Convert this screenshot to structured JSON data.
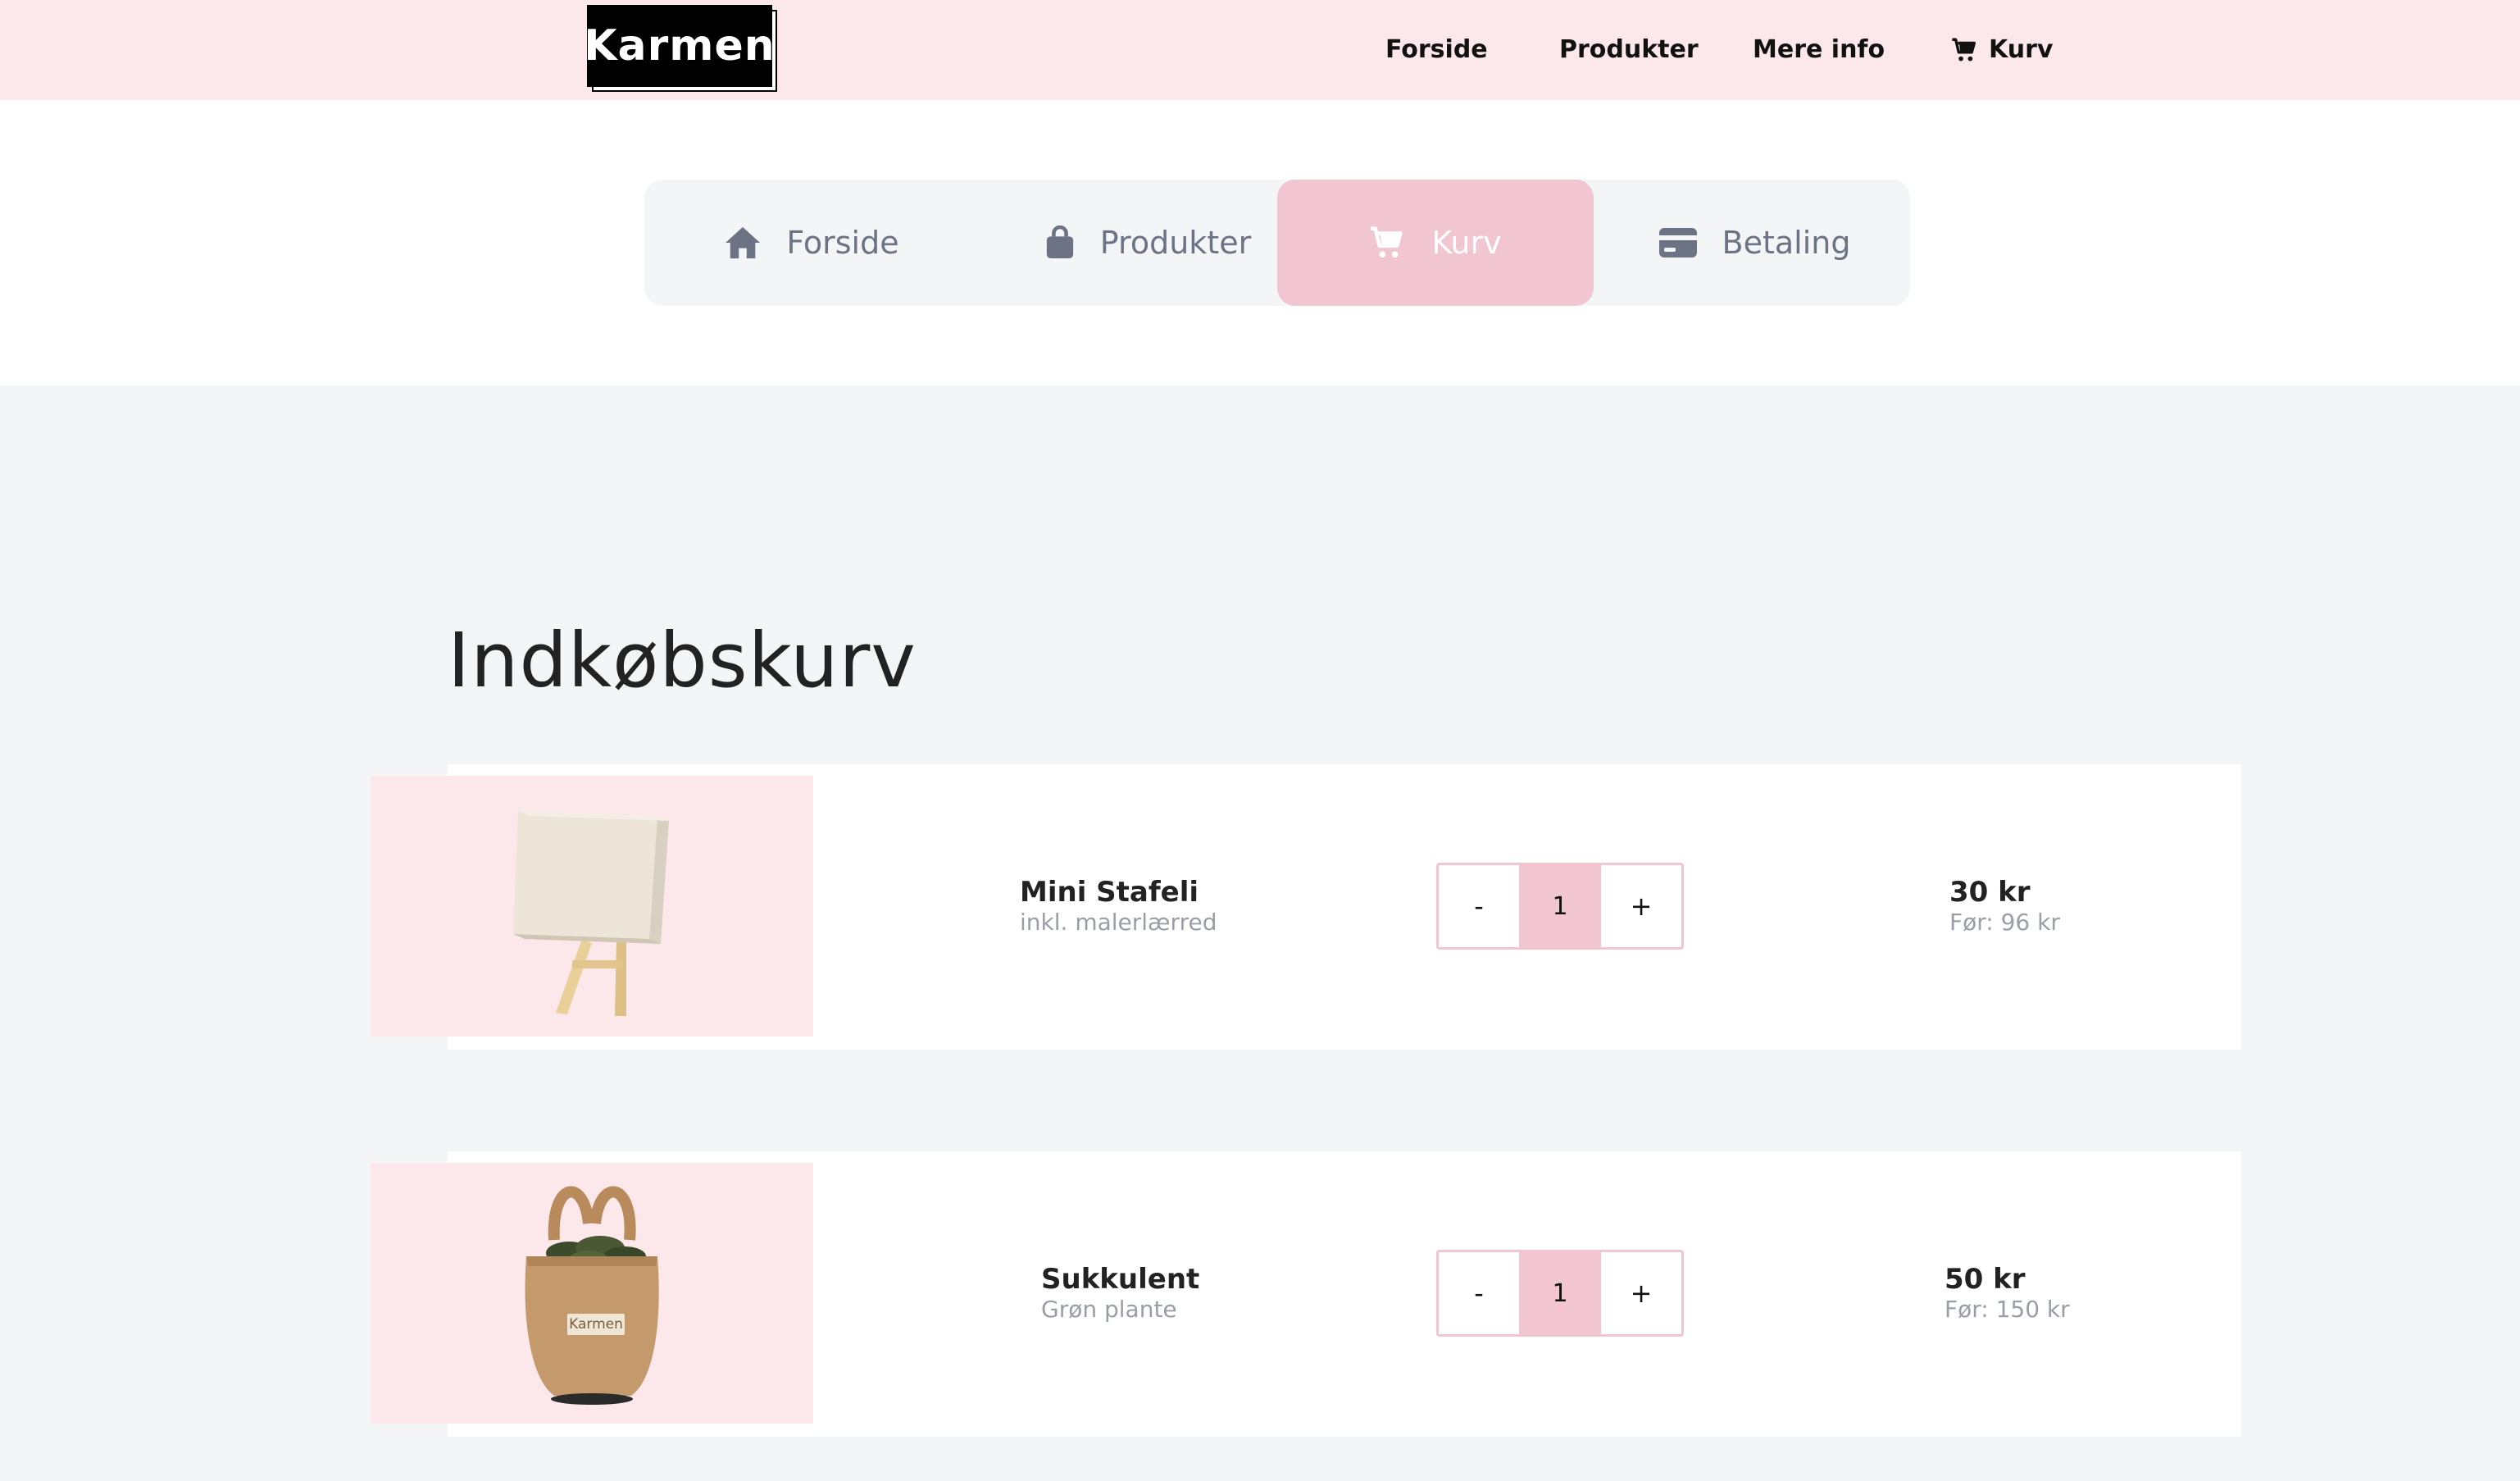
{
  "header": {
    "logo_text": "Karmen",
    "nav": [
      {
        "label": "Forside"
      },
      {
        "label": "Produkter"
      },
      {
        "label": "Mere info"
      },
      {
        "label": "Kurv",
        "icon": "cart-icon"
      }
    ]
  },
  "steps": [
    {
      "label": "Forside",
      "icon": "home-icon",
      "active": false
    },
    {
      "label": "Produkter",
      "icon": "shopping-bag-icon",
      "active": false
    },
    {
      "label": "Kurv",
      "icon": "cart-icon",
      "active": true
    },
    {
      "label": "Betaling",
      "icon": "credit-card-icon",
      "active": false
    }
  ],
  "cart": {
    "title": "Indkøbskurv",
    "items": [
      {
        "name": "Mini Stafeli",
        "subtitle": "inkl. malerlærred",
        "quantity": "1",
        "price": "30 kr",
        "before": "Før: 96 kr",
        "decrement": "-",
        "increment": "+"
      },
      {
        "name": "Sukkulent",
        "subtitle": "Grøn plante",
        "quantity": "1",
        "price": "50 kr",
        "before": "Før: 150 kr",
        "decrement": "-",
        "increment": "+",
        "product_print": "Karmen"
      }
    ]
  },
  "colors": {
    "header_bg": "#fce8ea",
    "accent_pink": "#f1c6d1",
    "page_bg": "#f4f5f7",
    "muted_text": "#6b7384"
  }
}
